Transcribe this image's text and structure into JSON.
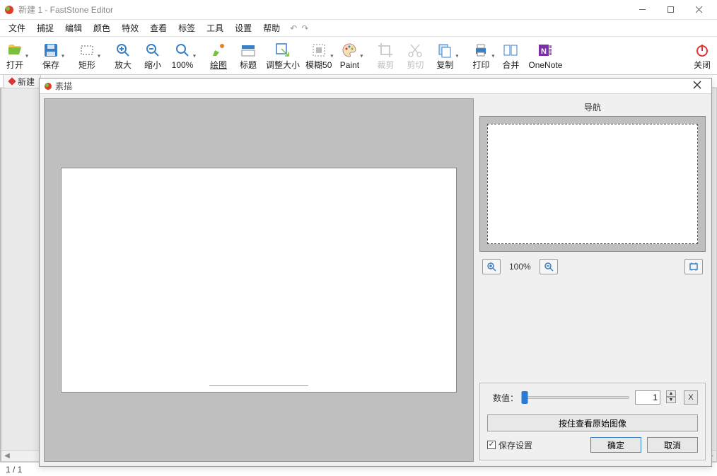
{
  "window": {
    "title": "新建 1 - FastStone Editor",
    "min_label": "最小化",
    "max_label": "最大化",
    "close_label": "关闭"
  },
  "menu": {
    "items": [
      "文件",
      "捕捉",
      "编辑",
      "颜色",
      "特效",
      "查看",
      "标签",
      "工具",
      "设置",
      "帮助"
    ]
  },
  "toolbar": {
    "open": "打开",
    "save": "保存",
    "rect": "矩形",
    "zoom_in": "放大",
    "zoom_out": "缩小",
    "zoom_100": "100%",
    "draw": "绘图",
    "title_btn": "标题",
    "resize": "调整大小",
    "blur50": "模糊50",
    "paint": "Paint",
    "crop": "裁剪",
    "cut": "剪切",
    "copy": "复制",
    "print": "打印",
    "merge": "合并",
    "onenote": "OneNote",
    "close": "关闭"
  },
  "tab": {
    "label": "新建"
  },
  "dialog": {
    "title": "素描",
    "nav_label": "导航",
    "zoom_in": "放大",
    "zoom_100": "100%",
    "zoom_out": "缩小",
    "zoom_fit": "适应",
    "value_label": "数值：",
    "value": "1",
    "x_label": "X",
    "hold_label": "按住查看原始图像",
    "save_settings": "保存设置",
    "save_checked": "✓",
    "ok": "确定",
    "cancel": "取消"
  },
  "status": {
    "page": "1 / 1"
  }
}
